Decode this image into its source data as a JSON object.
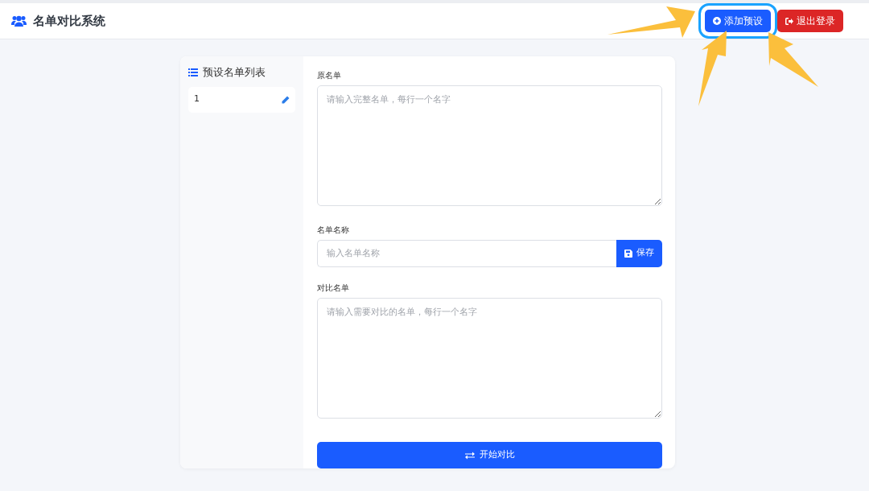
{
  "navbar": {
    "brand": "名单对比系统",
    "buttons": [
      {
        "label": "添加预设",
        "kind": "add",
        "highlighted": true
      },
      {
        "label": "退出登录",
        "kind": "logout",
        "highlighted": false
      }
    ]
  },
  "sidebar": {
    "title": "预设名单列表",
    "items": [
      {
        "label": "1"
      }
    ]
  },
  "form": {
    "original": {
      "label": "原名单",
      "placeholder": "请输入完整名单，每行一个名字"
    },
    "name": {
      "label": "名单名称",
      "placeholder": "输入名单名称",
      "button": "保存"
    },
    "compare": {
      "label": "对比名单",
      "placeholder": "请输入需要对比的名单，每行一个名字"
    },
    "submit": "开始对比"
  },
  "annotation_arrows": [
    {
      "kind": "rightward"
    },
    {
      "kind": "upward"
    },
    {
      "kind": "diagonal"
    }
  ]
}
